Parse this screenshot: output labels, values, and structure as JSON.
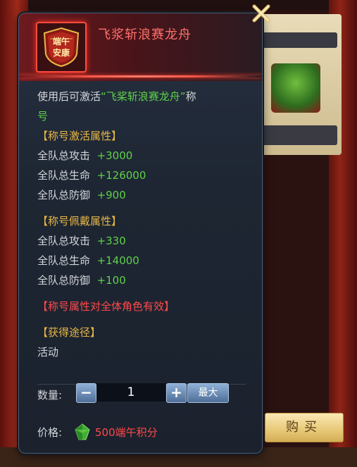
{
  "item": {
    "title": "飞浆斩浪赛龙舟",
    "badge_line1": "端午",
    "badge_line2": "安康",
    "icon": "festival-title-badge-icon"
  },
  "description": {
    "prefix": "使用后可激活",
    "name_quoted": "“飞桨斩浪赛龙舟”",
    "suffix_same_line": "称",
    "suffix_next_line": "号"
  },
  "activate_section": {
    "header": "【称号激活属性】",
    "stats": [
      {
        "label": "全队总攻击",
        "value": "+3000"
      },
      {
        "label": "全队总生命",
        "value": "+126000"
      },
      {
        "label": "全队总防御",
        "value": "+900"
      }
    ]
  },
  "wear_section": {
    "header": "【称号佩戴属性】",
    "stats": [
      {
        "label": "全队总攻击",
        "value": "+330"
      },
      {
        "label": "全队总生命",
        "value": "+14000"
      },
      {
        "label": "全队总防御",
        "value": "+100"
      }
    ]
  },
  "notice": "【称号属性对全体角色有效】",
  "obtain": {
    "header": "【获得途径】",
    "source": "活动"
  },
  "quantity": {
    "label": "数量:",
    "value": "1",
    "minus": "−",
    "plus": "+",
    "max_label": "最大"
  },
  "price": {
    "label": "价格:",
    "value": "500端午积分",
    "currency_icon": "green-gem-icon"
  },
  "buy_button": "购买",
  "close_icon": "close-x-icon",
  "colors": {
    "title": "#ff6f6a",
    "highlight_green": "#5fd14a",
    "section_gold": "#e8b746",
    "notice_red": "#ff4a4a",
    "accent_frame": "#ff4a3c"
  }
}
